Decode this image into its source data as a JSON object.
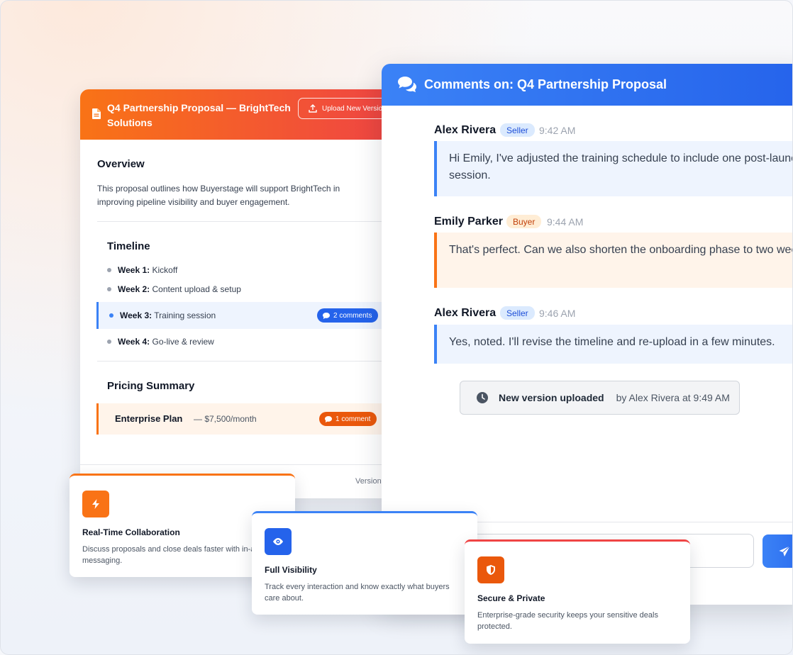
{
  "proposal": {
    "title": "Q4 Partnership Proposal — BrightTech Solutions",
    "upload_label": "Upload New Version",
    "overview_heading": "Overview",
    "overview_text": "This proposal outlines how Buyerstage will support BrightTech in improving pipeline visibility and buyer engagement.",
    "timeline_heading": "Timeline",
    "timeline": [
      {
        "week": "Week 1:",
        "task": "Kickoff"
      },
      {
        "week": "Week 2:",
        "task": "Content upload & setup"
      },
      {
        "week": "Week 3:",
        "task": "Training session",
        "comments": "2 comments"
      },
      {
        "week": "Week 4:",
        "task": "Go-live & review"
      }
    ],
    "pricing_heading": "Pricing Summary",
    "plan_name": "Enterprise Plan",
    "plan_price": "— $7,500/month",
    "plan_comments": "1 comment",
    "version_label": "Version"
  },
  "comments": {
    "title": "Comments on: Q4 Partnership Proposal",
    "messages": [
      {
        "author": "Alex Rivera",
        "role": "Seller",
        "time": "9:42 AM",
        "text": "Hi Emily, I've adjusted the training schedule to include one post-launch session."
      },
      {
        "author": "Emily Parker",
        "role": "Buyer",
        "time": "9:44 AM",
        "text": "That's perfect. Can we also shorten the onboarding phase to two weeks?"
      },
      {
        "author": "Alex Rivera",
        "role": "Seller",
        "time": "9:46 AM",
        "text": "Yes, noted. I'll revise the timeline and re-upload in a few minutes."
      }
    ],
    "event": {
      "label": "New version uploaded",
      "by": "by Alex Rivera at 9:49 AM"
    }
  },
  "features": [
    {
      "icon": "lightning-icon",
      "title": "Real-Time Collaboration",
      "desc_line1": "Discuss proposals and close deals faster with in-app",
      "desc_line2": "messaging."
    },
    {
      "icon": "eye-icon",
      "title": "Full Visibility",
      "desc_line1": "Track every interaction and know exactly what buyers",
      "desc_line2": "care about."
    },
    {
      "icon": "shield-icon",
      "title": "Secure & Private",
      "desc_line1": "Enterprise-grade security keeps your sensitive deals",
      "desc_line2": "protected."
    }
  ],
  "colors": {
    "orange": "#f97316",
    "red": "#ef4444",
    "blue": "#2563eb"
  }
}
